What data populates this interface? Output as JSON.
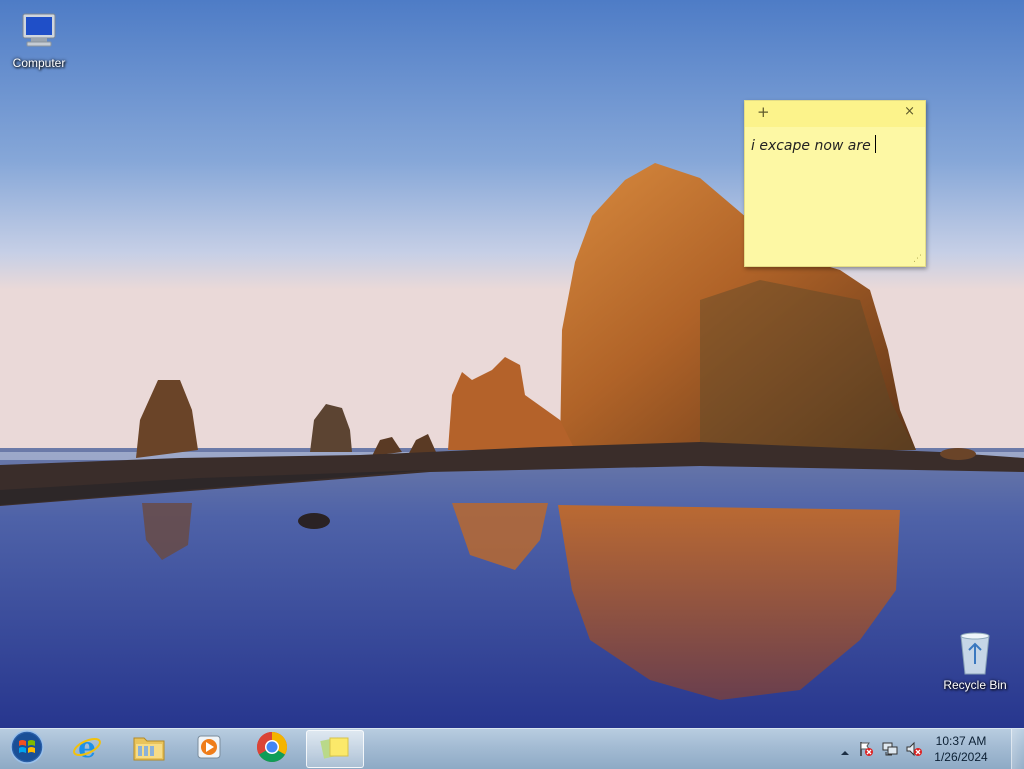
{
  "desktop": {
    "icons": [
      {
        "label": "Computer",
        "icon": "computer-icon"
      },
      {
        "label": "Recycle Bin",
        "icon": "recycle-bin-icon"
      }
    ]
  },
  "sticky_note": {
    "text": "i excape now are",
    "new_note_glyph": "+",
    "close_glyph": "×",
    "color": "#fdf8a4"
  },
  "taskbar": {
    "start_icon": "windows-start-orb-icon",
    "pinned": [
      {
        "name": "internet-explorer",
        "icon": "internet-explorer-icon"
      },
      {
        "name": "windows-explorer",
        "icon": "folder-icon"
      },
      {
        "name": "media-player",
        "icon": "media-player-icon"
      },
      {
        "name": "chrome",
        "icon": "chrome-icon"
      },
      {
        "name": "sticky-notes",
        "icon": "sticky-notes-icon",
        "active": true
      }
    ],
    "tray": {
      "time": "10:37 AM",
      "date": "1/26/2024",
      "icons": [
        "show-hidden-icons",
        "action-center-flag-icon",
        "network-icon",
        "volume-muted-icon"
      ]
    }
  }
}
